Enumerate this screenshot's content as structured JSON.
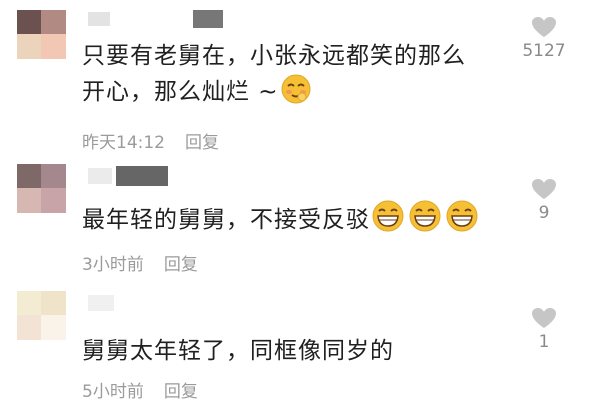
{
  "colors": {
    "text": "#202020",
    "meta": "#9b9b9b",
    "like": "#c6c6c6",
    "emoji": "#f6c034"
  },
  "comments": [
    {
      "text_line1": "只要有老舅在，小张永远都笑的那么",
      "text_line2": "开心，那么灿烂 ~",
      "emoji": "shy-smile-emoji",
      "time": "昨天14:12",
      "reply": "回复",
      "likes": "5127"
    },
    {
      "text": "最年轻的舅舅，不接受反驳",
      "emoji": "grin-emoji",
      "time": "3小时前",
      "reply": "回复",
      "likes": "9"
    },
    {
      "text": "舅舅太年轻了，同框像同岁的",
      "time": "5小时前",
      "reply": "回复",
      "likes": "1"
    }
  ]
}
